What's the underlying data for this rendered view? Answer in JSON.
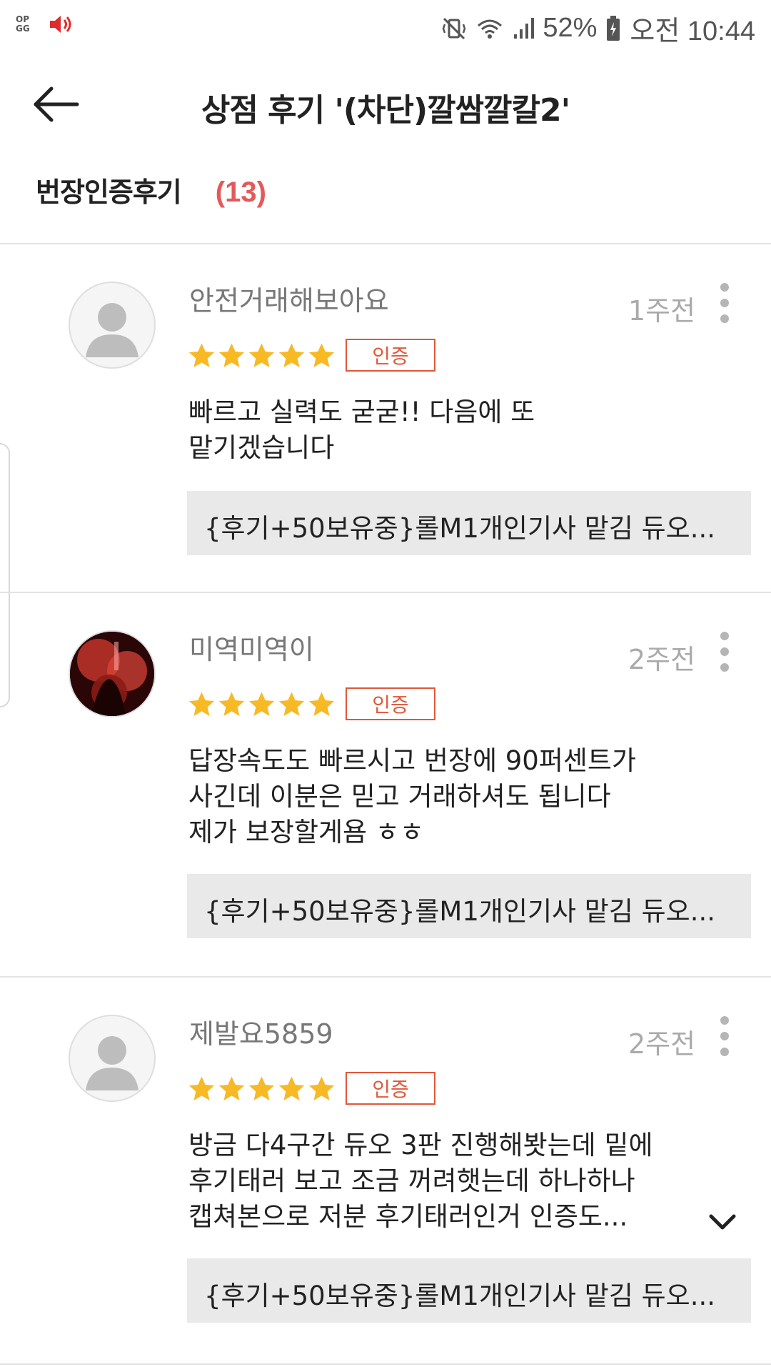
{
  "status_bar": {
    "left_icon": "opgg-icon",
    "sound_icon": "speaker-icon",
    "battery": "52%",
    "time": "오전 10:44",
    "right_icons": [
      "vibrate-icon",
      "wifi-icon",
      "signal-icon",
      "battery-icon"
    ]
  },
  "header": {
    "title": "상점 후기 '(차단)깔쌈깔칼2'",
    "back_icon": "back-arrow-icon"
  },
  "section": {
    "title": "번장인증후기",
    "count": "(13)"
  },
  "reviews": [
    {
      "reviewer": "안전거래해보아요",
      "time": "1주전",
      "rating": 5,
      "badge": "인증",
      "text": "빠르고 실력도 굳굳!! 다음에 또\n맡기겠습니다",
      "product": "{후기+50보유중}롤M1개인기사 맡김 듀오..."
    },
    {
      "reviewer": "미역미역이",
      "time": "2주전",
      "rating": 5,
      "badge": "인증",
      "text": "답장속도도 빠르시고 번장에 90퍼센트가\n사긴데 이분은 믿고 거래하셔도 됩니다\n제가 보장할게욤 ㅎㅎ",
      "product": "{후기+50보유중}롤M1개인기사 맡김 듀오..."
    },
    {
      "reviewer": "제발요5859",
      "time": "2주전",
      "rating": 5,
      "badge": "인증",
      "text": "방금 다4구간 듀오 3판 진행해봣는데 밑에\n후기태러 보고 조금 꺼려햇는데 하나하나\n캡쳐본으로 저분 후기태러인거 인증도...",
      "product": "{후기+50보유중}롤M1개인기사 맡김 듀오..."
    }
  ],
  "colors": {
    "accent_red": "#e35a5a",
    "badge_orange": "#e0583a",
    "star_yellow": "#f7b924"
  }
}
